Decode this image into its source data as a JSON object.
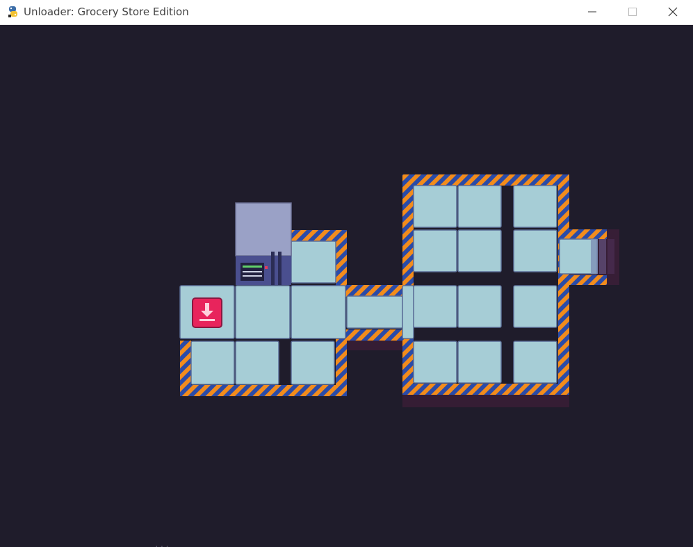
{
  "window": {
    "title": "Unloader: Grocery Store Edition",
    "app_icon": "python-snake-icon",
    "controls": {
      "minimize_icon": "minimize-icon",
      "maximize_icon": "maximize-icon",
      "close_icon": "close-icon"
    }
  },
  "game": {
    "background_color": "#1f1c2b",
    "floor_color": "#a6cdd6",
    "hazard_colors": [
      "#f28c1c",
      "#2a4ba8"
    ],
    "objects": [
      {
        "kind": "computer-terminal",
        "icon": "terminal-machine-icon"
      },
      {
        "kind": "drop-off-pad",
        "icon": "download-arrow-icon",
        "color": "#e8245c"
      }
    ],
    "bottom_text": "..."
  }
}
